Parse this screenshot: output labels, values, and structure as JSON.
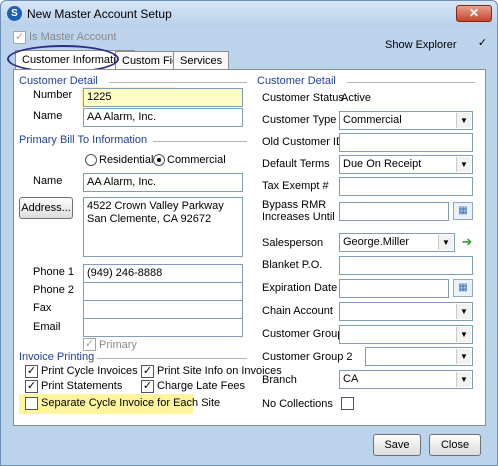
{
  "window": {
    "title": "New Master Account Setup",
    "close_label": "✕"
  },
  "top": {
    "is_master_label": "Is Master Account",
    "show_explorer_label": "Show Explorer"
  },
  "tabs": [
    {
      "label": "Customer Information"
    },
    {
      "label": "Custom Fields"
    },
    {
      "label": "Services"
    }
  ],
  "left": {
    "customer_detail_title": "Customer Detail",
    "number_label": "Number",
    "number_value": "1225",
    "name_label": "Name",
    "name_value": "AA Alarm, Inc.",
    "bill_to_title": "Primary Bill To Information",
    "residential_label": "Residential",
    "commercial_label": "Commercial",
    "bill_name_label": "Name",
    "bill_name_value": "AA Alarm, Inc.",
    "address_button": "Address...",
    "address_line1": "4522 Crown Valley Parkway",
    "address_line2": "San Clemente, CA  92672",
    "phone1_label": "Phone 1",
    "phone1_value": "(949) 246-8888",
    "phone2_label": "Phone 2",
    "phone2_value": "",
    "fax_label": "Fax",
    "fax_value": "",
    "email_label": "Email",
    "email_value": "",
    "primary_label": "Primary"
  },
  "invoice": {
    "title": "Invoice Printing",
    "print_cycle": "Print Cycle Invoices",
    "print_site_info": "Print Site Info on Invoices",
    "print_statements": "Print Statements",
    "charge_late_fees": "Charge Late Fees",
    "separate_cycle": "Separate Cycle Invoice for Each Site"
  },
  "right": {
    "title": "Customer Detail",
    "status_label": "Customer Status",
    "status_value": "Active",
    "type_label": "Customer Type",
    "type_value": "Commercial",
    "old_id_label": "Old Customer ID",
    "old_id_value": "",
    "terms_label": "Default Terms",
    "terms_value": "Due On Receipt",
    "tax_label": "Tax Exempt #",
    "tax_value": "",
    "bypass_label_1": "Bypass RMR",
    "bypass_label_2": "Increases Until",
    "bypass_value": "",
    "salesperson_label": "Salesperson",
    "salesperson_value": "George.Miller",
    "blanket_label": "Blanket P.O.",
    "blanket_value": "",
    "expiration_label": "Expiration Date",
    "expiration_value": "",
    "chain_label": "Chain Account",
    "chain_value": "",
    "group_label": "Customer Group",
    "group_value": "",
    "group2_label": "Customer Group 2",
    "group2_value": "",
    "branch_label": "Branch",
    "branch_value": "CA",
    "no_collections_label": "No Collections"
  },
  "buttons": {
    "save": "Save",
    "close": "Close"
  }
}
